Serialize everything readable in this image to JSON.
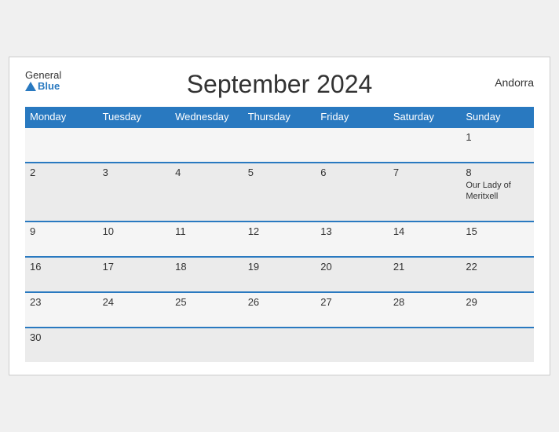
{
  "logo": {
    "general": "General",
    "blue": "Blue"
  },
  "header": {
    "title": "September 2024",
    "country": "Andorra"
  },
  "weekdays": [
    "Monday",
    "Tuesday",
    "Wednesday",
    "Thursday",
    "Friday",
    "Saturday",
    "Sunday"
  ],
  "weeks": [
    [
      {
        "day": "",
        "event": ""
      },
      {
        "day": "",
        "event": ""
      },
      {
        "day": "",
        "event": ""
      },
      {
        "day": "",
        "event": ""
      },
      {
        "day": "",
        "event": ""
      },
      {
        "day": "",
        "event": ""
      },
      {
        "day": "1",
        "event": ""
      }
    ],
    [
      {
        "day": "2",
        "event": ""
      },
      {
        "day": "3",
        "event": ""
      },
      {
        "day": "4",
        "event": ""
      },
      {
        "day": "5",
        "event": ""
      },
      {
        "day": "6",
        "event": ""
      },
      {
        "day": "7",
        "event": ""
      },
      {
        "day": "8",
        "event": "Our Lady of Meritxell"
      }
    ],
    [
      {
        "day": "9",
        "event": ""
      },
      {
        "day": "10",
        "event": ""
      },
      {
        "day": "11",
        "event": ""
      },
      {
        "day": "12",
        "event": ""
      },
      {
        "day": "13",
        "event": ""
      },
      {
        "day": "14",
        "event": ""
      },
      {
        "day": "15",
        "event": ""
      }
    ],
    [
      {
        "day": "16",
        "event": ""
      },
      {
        "day": "17",
        "event": ""
      },
      {
        "day": "18",
        "event": ""
      },
      {
        "day": "19",
        "event": ""
      },
      {
        "day": "20",
        "event": ""
      },
      {
        "day": "21",
        "event": ""
      },
      {
        "day": "22",
        "event": ""
      }
    ],
    [
      {
        "day": "23",
        "event": ""
      },
      {
        "day": "24",
        "event": ""
      },
      {
        "day": "25",
        "event": ""
      },
      {
        "day": "26",
        "event": ""
      },
      {
        "day": "27",
        "event": ""
      },
      {
        "day": "28",
        "event": ""
      },
      {
        "day": "29",
        "event": ""
      }
    ],
    [
      {
        "day": "30",
        "event": ""
      },
      {
        "day": "",
        "event": ""
      },
      {
        "day": "",
        "event": ""
      },
      {
        "day": "",
        "event": ""
      },
      {
        "day": "",
        "event": ""
      },
      {
        "day": "",
        "event": ""
      },
      {
        "day": "",
        "event": ""
      }
    ]
  ]
}
